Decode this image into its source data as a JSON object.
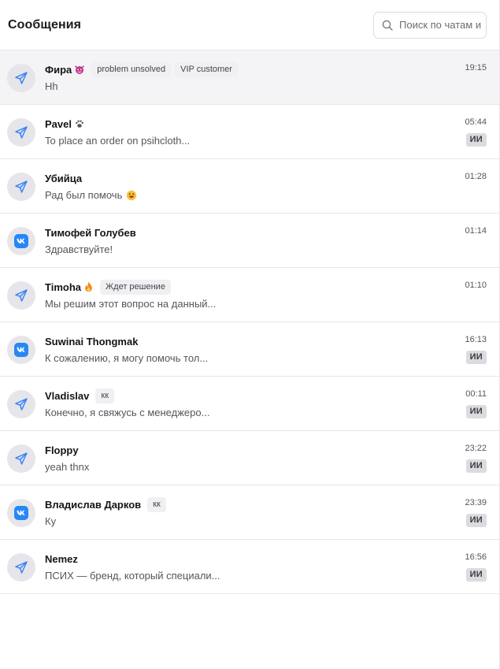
{
  "header": {
    "title": "Сообщения",
    "search_placeholder": "Поиск по чатам и"
  },
  "colors": {
    "accent": "#2787f5",
    "telegram_icon": "#3b82f6",
    "selected_row": "#f4f4f6",
    "avatar_bg": "#e6e6ea",
    "ai_badge_bg": "#dcdce0"
  },
  "chats": [
    {
      "channel": "telegram",
      "name": "Фира",
      "emoji": "devil-icon",
      "tags": [
        "problem unsolved",
        "VIP customer"
      ],
      "preview": "Hh",
      "time": "19:15",
      "ai": "",
      "selected": true
    },
    {
      "channel": "telegram",
      "name": "Pavel",
      "emoji": "paw-icon",
      "tags": [],
      "preview": "To place an order on psihcloth...",
      "time": "05:44",
      "ai": "ИИ",
      "selected": false
    },
    {
      "channel": "telegram",
      "name": "Убийца",
      "emoji": "",
      "tags": [],
      "preview": "Рад был помочь",
      "preview_emoji": "grin-icon",
      "time": "01:28",
      "ai": "",
      "selected": false
    },
    {
      "channel": "vk",
      "name": "Тимофей Голубев",
      "emoji": "",
      "tags": [],
      "preview": "Здравствуйте!",
      "time": "01:14",
      "ai": "",
      "selected": false
    },
    {
      "channel": "telegram",
      "name": "Timoha",
      "emoji": "fire-icon",
      "tags": [
        "Ждет решение"
      ],
      "preview": "Мы решим этот вопрос на данный...",
      "time": "01:10",
      "ai": "",
      "selected": false
    },
    {
      "channel": "vk",
      "name": "Suwinai Thongmak",
      "emoji": "",
      "tags": [],
      "preview": "К сожалению, я могу помочь тол...",
      "time": "16:13",
      "ai": "ИИ",
      "selected": false
    },
    {
      "channel": "telegram",
      "name": "Vladislav",
      "emoji": "",
      "tags": [
        "кк"
      ],
      "preview": "Конечно, я свяжусь с менеджеро...",
      "time": "00:11",
      "ai": "ИИ",
      "selected": false
    },
    {
      "channel": "telegram",
      "name": "Floppy",
      "emoji": "",
      "tags": [],
      "preview": "yeah thnx",
      "time": "23:22",
      "ai": "ИИ",
      "selected": false
    },
    {
      "channel": "vk",
      "name": "Владислав Дарков",
      "emoji": "",
      "tags": [
        "кк"
      ],
      "preview": "Ку",
      "time": "23:39",
      "ai": "ИИ",
      "selected": false
    },
    {
      "channel": "telegram",
      "name": "Nemez",
      "emoji": "",
      "tags": [],
      "preview": "ПСИХ — бренд, который специали...",
      "time": "16:56",
      "ai": "ИИ",
      "selected": false
    }
  ]
}
